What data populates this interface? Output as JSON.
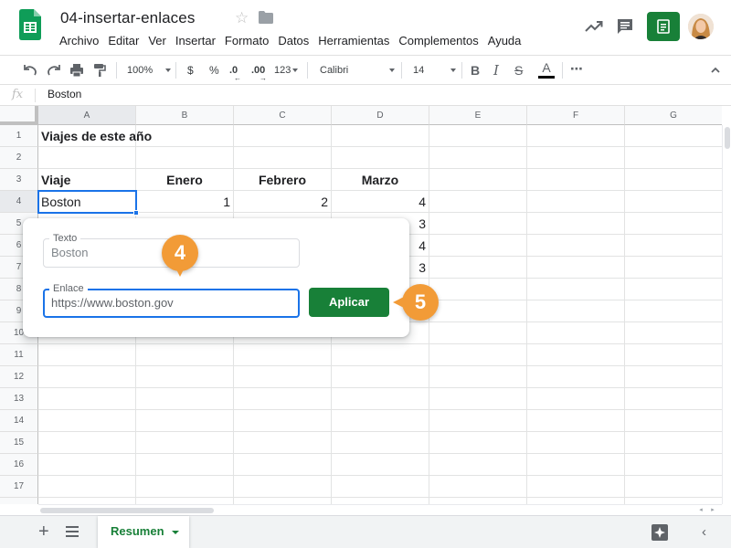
{
  "header": {
    "doc_title": "04-insertar-enlaces",
    "menu": [
      "Archivo",
      "Editar",
      "Ver",
      "Insertar",
      "Formato",
      "Datos",
      "Herramientas",
      "Complementos",
      "Ayuda"
    ],
    "icons": [
      "sheets-logo-icon",
      "star-icon",
      "folder-icon",
      "trending-icon",
      "comment-icon",
      "share-icon",
      "avatar"
    ]
  },
  "toolbar": {
    "zoom": "100%",
    "currency": "$",
    "percent": "%",
    "decrease_decimals": ".0",
    "increase_decimals": ".00",
    "number_format": "123",
    "font": "Calibri",
    "font_size": "14",
    "more": "⋯"
  },
  "formula_bar": {
    "fx": "fx",
    "value": "Boston"
  },
  "grid": {
    "columns": [
      "A",
      "B",
      "C",
      "D",
      "E",
      "F",
      "G"
    ],
    "rows": [
      "1",
      "2",
      "3",
      "4",
      "5",
      "6",
      "7",
      "8",
      "9",
      "10",
      "11",
      "12",
      "13",
      "14",
      "15",
      "16",
      "17"
    ],
    "cells": {
      "a1": "Viajes de este año",
      "a3": "Viaje",
      "b3": "Enero",
      "c3": "Febrero",
      "d3": "Marzo",
      "a4": "Boston",
      "b4": "1",
      "c4": "2",
      "d4": "4",
      "d5": "3",
      "d6": "4",
      "d7": "3"
    },
    "selected_cell": "A4"
  },
  "link_popup": {
    "text_label": "Texto",
    "text_value": "Boston",
    "link_label": "Enlace",
    "link_value": "https://www.boston.gov",
    "apply_label": "Aplicar"
  },
  "callouts": {
    "step_4": "4",
    "step_5": "5"
  },
  "sheet_tabs": {
    "add": "+",
    "active_tab": "Resumen"
  },
  "colors": {
    "accent_green": "#188038",
    "selection_blue": "#1a73e8",
    "callout_orange": "#f29b37"
  }
}
